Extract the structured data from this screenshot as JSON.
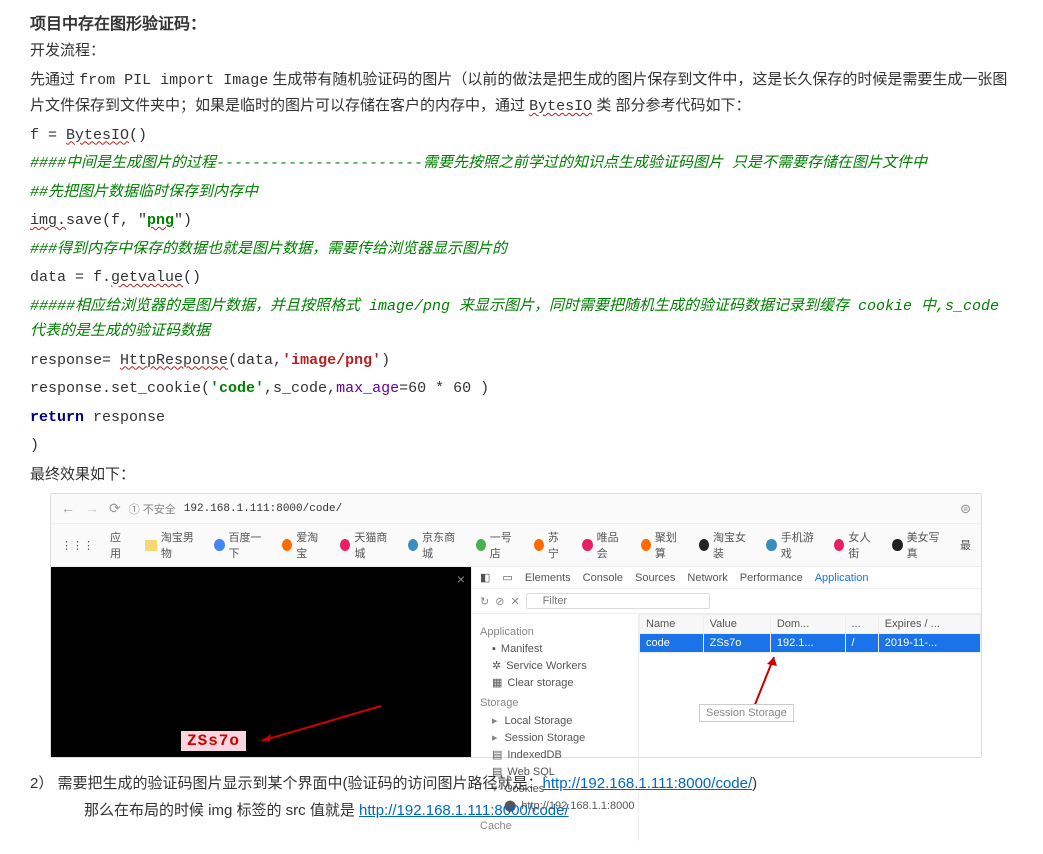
{
  "doc": {
    "title": "项目中存在图形验证码：",
    "subtitle": "开发流程：",
    "para1a": "先通过 ",
    "para1b": "from PIL import Image",
    "para1c": " 生成带有随机验证码的图片（以前的做法是把生成的图片保存到文件中，这是长久保存的时候是需要生成一张图片文件保存到文件夹中；如果是临时的图片可以存储在客户的内存中，通过 ",
    "para1d": "BytesIO",
    "para1e": " 类  部分参考代码如下：",
    "result_label": "最终效果如下：",
    "item2_num": "2）",
    "item2_a": "需要把生成的验证码图片显示到某个界面中(验证码的访问图片路径就是：",
    "item2_b": ")",
    "item2_c": "那么在布局的时候 img 标签的 src 值就是 ",
    "url": "http://192.168.1.111:8000/code/"
  },
  "code": {
    "l1a": "f = ",
    "l1b": "BytesIO",
    "l1c": "()",
    "c1": "####中间是生成图片的过程-----------------------需要先按照之前学过的知识点生成验证码图片 只是不需要存储在图片文件中",
    "c2": "##先把图片数据临时保存到内存中",
    "l2a": "img.",
    "l2b": "save(f, \"",
    "l2c": "png",
    "l2d": "\")",
    "c3": "###得到内存中保存的数据也就是图片数据，需要传给浏览器显示图片的",
    "l3a": "data = f.",
    "l3b": "getvalue",
    "l3c": "()",
    "c4": "#####相应给浏览器的是图片数据，并且按照格式 image/png 来显示图片，同时需要把随机生成的验证码数据记录到缓存 cookie 中,s_code 代表的是生成的验证码数据",
    "l4a": "response= ",
    "l4b": "HttpResponse",
    "l4c": "(data,",
    "l4d": "'image/png'",
    "l4e": ")",
    "l5a": "response.set_cookie(",
    "l5b": "'code'",
    "l5c": ",s_code,",
    "l5d": "max_age",
    "l5e": "=60 * 60 )",
    "l6a": "return",
    "l6b": " response",
    "l7": ")"
  },
  "browser": {
    "insecure": "① 不安全",
    "address": "192.168.1.111:8000/code/",
    "bookmarks": [
      "应用",
      "淘宝男物",
      "百度一下",
      "爱淘宝",
      "天猫商城",
      "京东商城",
      "一号店",
      "苏宁",
      "唯品会",
      "聚划算",
      "淘宝女装",
      "手机游戏",
      "女人街",
      "美女写真",
      "最"
    ],
    "captcha_text": "ZSs7o",
    "dev_tabs": [
      "Elements",
      "Console",
      "Sources",
      "Network",
      "Performance",
      "Application"
    ],
    "filter_placeholder": "Filter",
    "no_results": "⊘",
    "sidebar": {
      "app_label": "Application",
      "manifest": "Manifest",
      "service_workers": "Service Workers",
      "clear_storage": "Clear storage",
      "storage_label": "Storage",
      "local_storage": "Local Storage",
      "session_storage": "Session Storage",
      "indexeddb": "IndexedDB",
      "websql": "Web SQL",
      "cookies": "Cookies",
      "cookie_host": "http://192.168.1.1:8000",
      "cache_label": "Cache"
    },
    "tooltip": "Session Storage",
    "table": {
      "headers": [
        "Name",
        "Value",
        "Dom...",
        "...",
        "Expires / ..."
      ],
      "row": [
        "code",
        "ZSs7o",
        "192.1...",
        "/",
        "2019-11-..."
      ]
    }
  }
}
